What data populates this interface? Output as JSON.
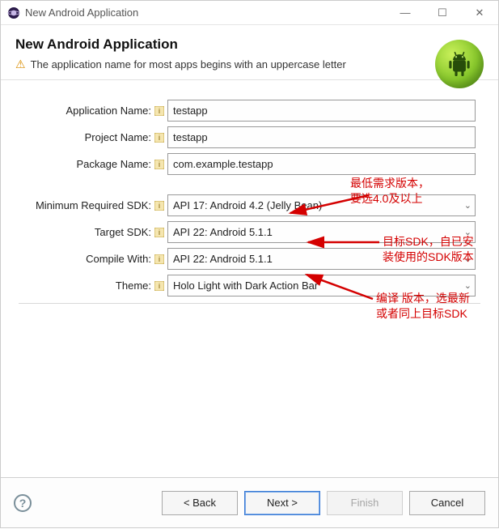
{
  "window": {
    "title": "New Android Application",
    "minimize_glyph": "—",
    "maximize_glyph": "☐",
    "close_glyph": "✕"
  },
  "header": {
    "title": "New Android Application",
    "warning": "The application name for most apps begins with an uppercase letter"
  },
  "form": {
    "app_name": {
      "label": "Application Name:",
      "value": "testapp"
    },
    "project_name": {
      "label": "Project Name:",
      "value": "testapp"
    },
    "package_name": {
      "label": "Package Name:",
      "value": "com.example.testapp"
    },
    "min_sdk": {
      "label": "Minimum Required SDK:",
      "value": "API 17: Android 4.2 (Jelly Bean)"
    },
    "target_sdk": {
      "label": "Target SDK:",
      "value": "API 22: Android 5.1.1"
    },
    "compile_with": {
      "label": "Compile With:",
      "value": "API 22: Android 5.1.1"
    },
    "theme": {
      "label": "Theme:",
      "value": "Holo Light with Dark Action Bar"
    }
  },
  "annotations": {
    "min_sdk_note_l1": "最低需求版本，",
    "min_sdk_note_l2": "要选4.0及以上",
    "target_sdk_note_l1": "目标SDK，自已安",
    "target_sdk_note_l2": "装使用的SDK版本",
    "compile_note_l1": "编译 版本，选最新",
    "compile_note_l2": "或者同上目标SDK"
  },
  "footer": {
    "back": "< Back",
    "next": "Next >",
    "finish": "Finish",
    "cancel": "Cancel"
  },
  "colors": {
    "anno": "#d40000"
  }
}
